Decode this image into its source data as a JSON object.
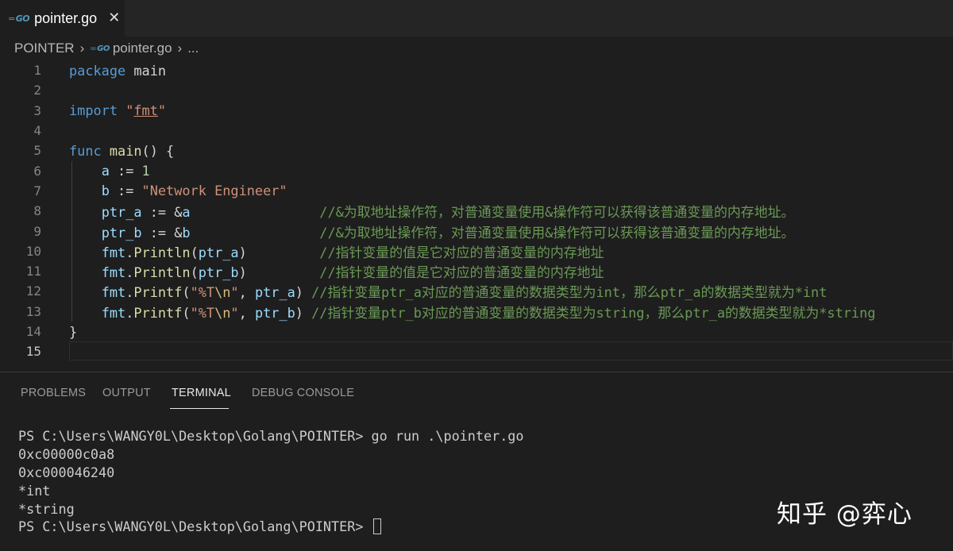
{
  "tab": {
    "icon": "go-icon",
    "title": "pointer.go",
    "close_glyph": "✕"
  },
  "breadcrumb": {
    "folder": "POINTER",
    "sep": "›",
    "file": "pointer.go",
    "more": "..."
  },
  "editor": {
    "line_numbers": [
      "1",
      "2",
      "3",
      "4",
      "5",
      "6",
      "7",
      "8",
      "9",
      "10",
      "11",
      "12",
      "13",
      "14",
      "15"
    ],
    "lines": [
      [
        {
          "t": "package",
          "c": "kw"
        },
        {
          "t": " main",
          "c": "pln"
        }
      ],
      [],
      [
        {
          "t": "import",
          "c": "kw"
        },
        {
          "t": " ",
          "c": "pln"
        },
        {
          "t": "\"",
          "c": "str"
        },
        {
          "t": "fmt",
          "c": "str fmt-underline"
        },
        {
          "t": "\"",
          "c": "str"
        }
      ],
      [],
      [
        {
          "t": "func",
          "c": "kw"
        },
        {
          "t": " ",
          "c": "pln"
        },
        {
          "t": "main",
          "c": "fn"
        },
        {
          "t": "() {",
          "c": "pln"
        }
      ],
      [
        {
          "t": "    ",
          "c": "pln"
        },
        {
          "t": "a",
          "c": "var"
        },
        {
          "t": " := ",
          "c": "pln"
        },
        {
          "t": "1",
          "c": "num"
        }
      ],
      [
        {
          "t": "    ",
          "c": "pln"
        },
        {
          "t": "b",
          "c": "var"
        },
        {
          "t": " := ",
          "c": "pln"
        },
        {
          "t": "\"Network Engineer\"",
          "c": "str"
        }
      ],
      [
        {
          "t": "    ",
          "c": "pln"
        },
        {
          "t": "ptr_a",
          "c": "var"
        },
        {
          "t": " := &",
          "c": "pln"
        },
        {
          "t": "a",
          "c": "var"
        },
        {
          "t": "                ",
          "c": "pln"
        },
        {
          "t": "//&为取地址操作符，对普通变量使用&操作符可以获得该普通变量的内存地址。",
          "c": "cmt"
        }
      ],
      [
        {
          "t": "    ",
          "c": "pln"
        },
        {
          "t": "ptr_b",
          "c": "var"
        },
        {
          "t": " := &",
          "c": "pln"
        },
        {
          "t": "b",
          "c": "var"
        },
        {
          "t": "                ",
          "c": "pln"
        },
        {
          "t": "//&为取地址操作符，对普通变量使用&操作符可以获得该普通变量的内存地址。",
          "c": "cmt"
        }
      ],
      [
        {
          "t": "    ",
          "c": "pln"
        },
        {
          "t": "fmt",
          "c": "var"
        },
        {
          "t": ".",
          "c": "pln"
        },
        {
          "t": "Println",
          "c": "fn"
        },
        {
          "t": "(",
          "c": "pln"
        },
        {
          "t": "ptr_a",
          "c": "var"
        },
        {
          "t": ")         ",
          "c": "pln"
        },
        {
          "t": "//指针变量的值是它对应的普通变量的内存地址",
          "c": "cmt"
        }
      ],
      [
        {
          "t": "    ",
          "c": "pln"
        },
        {
          "t": "fmt",
          "c": "var"
        },
        {
          "t": ".",
          "c": "pln"
        },
        {
          "t": "Println",
          "c": "fn"
        },
        {
          "t": "(",
          "c": "pln"
        },
        {
          "t": "ptr_b",
          "c": "var"
        },
        {
          "t": ")         ",
          "c": "pln"
        },
        {
          "t": "//指针变量的值是它对应的普通变量的内存地址",
          "c": "cmt"
        }
      ],
      [
        {
          "t": "    ",
          "c": "pln"
        },
        {
          "t": "fmt",
          "c": "var"
        },
        {
          "t": ".",
          "c": "pln"
        },
        {
          "t": "Printf",
          "c": "fn"
        },
        {
          "t": "(",
          "c": "pln"
        },
        {
          "t": "\"%T",
          "c": "str"
        },
        {
          "t": "\\n",
          "c": "esc"
        },
        {
          "t": "\"",
          "c": "str"
        },
        {
          "t": ", ",
          "c": "pln"
        },
        {
          "t": "ptr_a",
          "c": "var"
        },
        {
          "t": ") ",
          "c": "pln"
        },
        {
          "t": "//指针变量ptr_a对应的普通变量的数据类型为int，那么ptr_a的数据类型就为*int",
          "c": "cmt"
        }
      ],
      [
        {
          "t": "    ",
          "c": "pln"
        },
        {
          "t": "fmt",
          "c": "var"
        },
        {
          "t": ".",
          "c": "pln"
        },
        {
          "t": "Printf",
          "c": "fn"
        },
        {
          "t": "(",
          "c": "pln"
        },
        {
          "t": "\"%T",
          "c": "str"
        },
        {
          "t": "\\n",
          "c": "esc"
        },
        {
          "t": "\"",
          "c": "str"
        },
        {
          "t": ", ",
          "c": "pln"
        },
        {
          "t": "ptr_b",
          "c": "var"
        },
        {
          "t": ") ",
          "c": "pln"
        },
        {
          "t": "//指针变量ptr_b对应的普通变量的数据类型为string，那么ptr_a的数据类型就为*string",
          "c": "cmt"
        }
      ],
      [
        {
          "t": "}",
          "c": "pln"
        }
      ],
      []
    ],
    "active_line": 15
  },
  "panel": {
    "tabs": [
      "PROBLEMS",
      "OUTPUT",
      "TERMINAL",
      "DEBUG CONSOLE"
    ],
    "active_tab": "TERMINAL"
  },
  "terminal": {
    "lines": [
      "PS C:\\Users\\WANGY0L\\Desktop\\Golang\\POINTER> go run .\\pointer.go",
      "0xc00000c0a8",
      "0xc000046240",
      "*int",
      "*string",
      "PS C:\\Users\\WANGY0L\\Desktop\\Golang\\POINTER> "
    ]
  },
  "watermark": "知乎 @弈心"
}
